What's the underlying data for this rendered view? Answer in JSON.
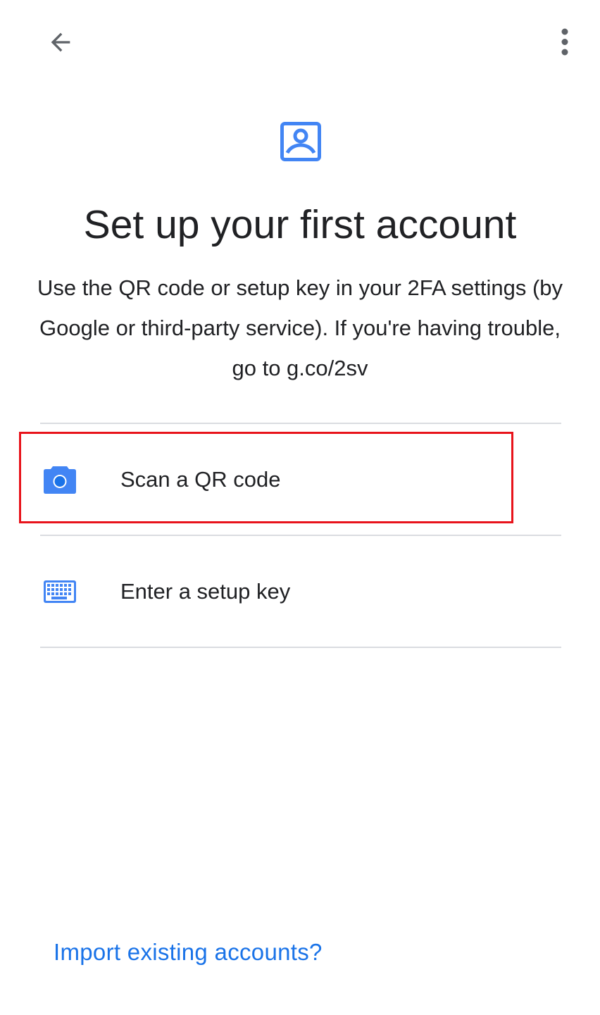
{
  "toolbar": {
    "back_icon": "arrow-back-icon",
    "menu_icon": "more-vert-icon"
  },
  "header": {
    "icon": "account-box-icon",
    "title": "Set up your first account",
    "description": "Use the QR code or setup key in your 2FA settings (by Google or third-party service). If you're having trouble, go to g.co/2sv"
  },
  "options": [
    {
      "icon": "camera-icon",
      "label": "Scan a QR code"
    },
    {
      "icon": "keyboard-icon",
      "label": "Enter a setup key"
    }
  ],
  "footer": {
    "import_link": "Import existing accounts?"
  },
  "colors": {
    "accent_blue": "#1a73e8",
    "icon_blue": "#4285f4",
    "text_primary": "#202124",
    "divider": "#dadce0",
    "highlight_red": "#e8131b"
  }
}
